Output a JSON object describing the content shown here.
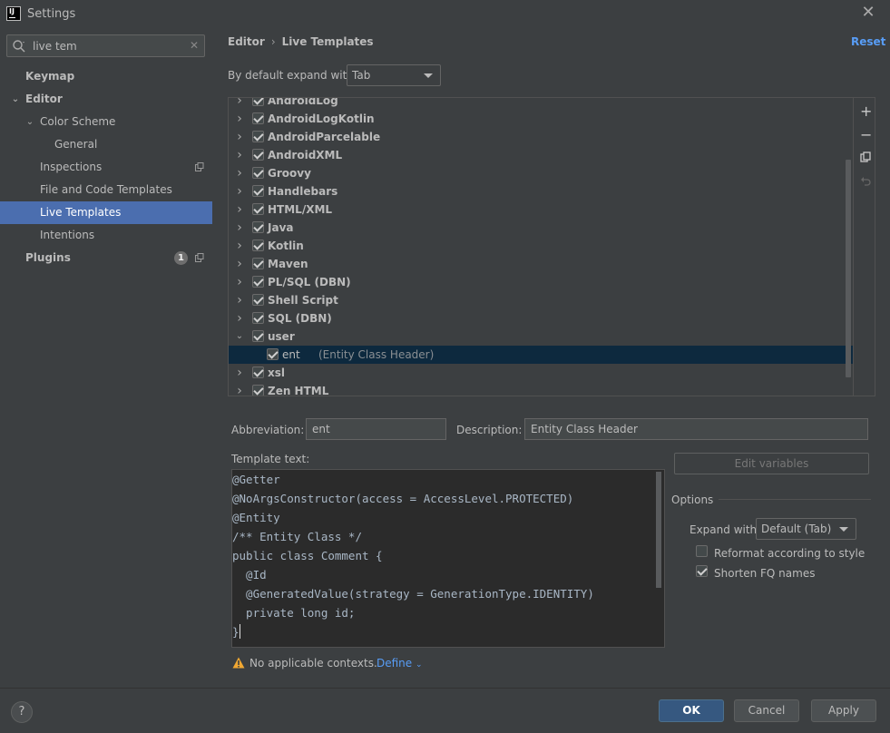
{
  "window": {
    "title": "Settings",
    "app_icon_text": "IJ"
  },
  "sidebar": {
    "search": {
      "value": "live tem",
      "placeholder": ""
    },
    "items": [
      {
        "label": "Keymap"
      },
      {
        "label": "Editor"
      },
      {
        "label": "Color Scheme"
      },
      {
        "label": "General"
      },
      {
        "label": "Inspections"
      },
      {
        "label": "File and Code Templates"
      },
      {
        "label": "Live Templates"
      },
      {
        "label": "Intentions"
      },
      {
        "label": "Plugins",
        "badge": "1"
      }
    ]
  },
  "main": {
    "breadcrumb": {
      "parent": "Editor",
      "separator": "›",
      "current": "Live Templates"
    },
    "reset_label": "Reset",
    "expand_default": {
      "label": "By default expand with",
      "value": "Tab"
    },
    "templates": [
      {
        "name": "AndroidLog",
        "expanded": false
      },
      {
        "name": "AndroidLogKotlin",
        "expanded": false
      },
      {
        "name": "AndroidParcelable",
        "expanded": false
      },
      {
        "name": "AndroidXML",
        "expanded": false
      },
      {
        "name": "Groovy",
        "expanded": false
      },
      {
        "name": "Handlebars",
        "expanded": false
      },
      {
        "name": "HTML/XML",
        "expanded": false
      },
      {
        "name": "Java",
        "expanded": false
      },
      {
        "name": "Kotlin",
        "expanded": false
      },
      {
        "name": "Maven",
        "expanded": false
      },
      {
        "name": "PL/SQL (DBN)",
        "expanded": false
      },
      {
        "name": "Shell Script",
        "expanded": false
      },
      {
        "name": "SQL (DBN)",
        "expanded": false
      },
      {
        "name": "user",
        "expanded": true
      },
      {
        "name": "ent",
        "description": "(Entity Class Header)",
        "child": true,
        "selected": true
      },
      {
        "name": "xsl",
        "expanded": false
      },
      {
        "name": "Zen HTML",
        "expanded": false
      }
    ],
    "toolbar": {
      "add": "+",
      "remove": "−",
      "copy": "copy",
      "revert": "revert"
    },
    "abbreviation": {
      "label": "Abbreviation:",
      "value": "ent"
    },
    "description": {
      "label": "Description:",
      "value": "Entity Class Header"
    },
    "template_text": {
      "label": "Template text:",
      "lines": [
        "@Getter",
        "@NoArgsConstructor(access = AccessLevel.PROTECTED)",
        "@Entity",
        "/** Entity Class */",
        "public class Comment {",
        "  @Id",
        "  @GeneratedValue(strategy = GenerationType.IDENTITY)",
        "  private long id;",
        "}"
      ]
    },
    "edit_variables_label": "Edit variables",
    "options": {
      "label": "Options",
      "expand_with": {
        "label": "Expand with",
        "value": "Default (Tab)"
      },
      "reformat": {
        "label": "Reformat according to style",
        "checked": false
      },
      "shorten": {
        "label": "Shorten FQ names",
        "checked": true
      }
    },
    "contexts": {
      "warning": "No applicable contexts.",
      "define_label": "Define"
    }
  },
  "footer": {
    "help": "?",
    "ok": "OK",
    "cancel": "Cancel",
    "apply": "Apply"
  },
  "colors": {
    "accent": "#4b6eaf",
    "link": "#589df6",
    "background": "#3c3f41",
    "editor_bg": "#2b2b2b",
    "selection": "#0d293e",
    "warning": "#f0a732"
  }
}
